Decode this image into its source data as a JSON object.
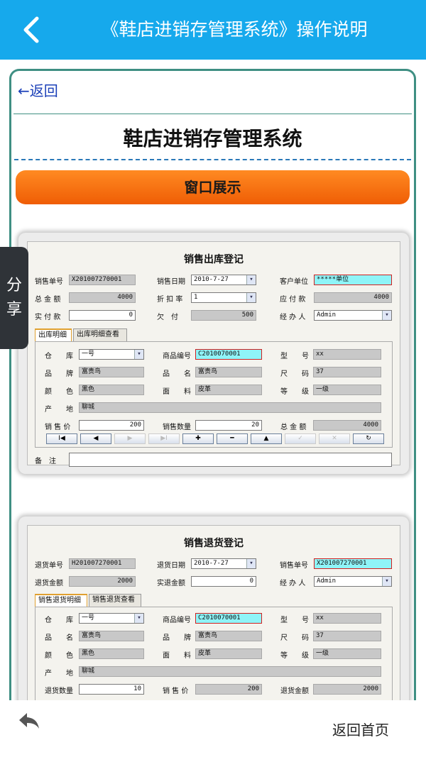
{
  "header": {
    "title": "《鞋店进销存管理系统》操作说明"
  },
  "content": {
    "back_link": "←返回",
    "main_title": "鞋店进销存管理系统",
    "section_title": "窗口展示"
  },
  "share_label": "分享",
  "footer": {
    "home_label": "返回首页"
  },
  "sales_out": {
    "title": "销售出库登记",
    "row1": {
      "l1": "销售单号",
      "v1": "X201007270001",
      "l2": "销售日期",
      "v2": "2010-7-27",
      "l3": "客户单位",
      "v3": "*****单位"
    },
    "row2": {
      "l1": "总 金 额",
      "v1": "4000",
      "l2": "折 扣 率",
      "v2": "1",
      "l3": "应 付 款",
      "v3": "4000"
    },
    "row3": {
      "l1": "实 付 款",
      "v1": "0",
      "l2": "欠　付",
      "v2": "500",
      "l3": "经 办 人",
      "v3": "Admin"
    },
    "tabs": [
      "出库明细",
      "出库明细查看"
    ],
    "detail": {
      "warehouse_l": "仓　　库",
      "warehouse_v": "一号",
      "code_l": "商品编号",
      "code_v": "C2010070001",
      "model_l": "型　　号",
      "model_v": "xx",
      "brand_l": "品　　牌",
      "brand_v": "富贵鸟",
      "name_l": "品　　名",
      "name_v": "富贵鸟",
      "size_l": "尺　　码",
      "size_v": "37",
      "color_l": "颜　　色",
      "color_v": "黑色",
      "material_l": "面　　料",
      "material_v": "皮革",
      "grade_l": "等　　级",
      "grade_v": "一级",
      "origin_l": "产　　地",
      "origin_v": "聊城",
      "price_l": "销 售 价",
      "price_v": "200",
      "qty_l": "销售数量",
      "qty_v": "20",
      "total_l": "总 金 额",
      "total_v": "4000"
    },
    "nav_buttons": [
      "I◀",
      "◀",
      "▶",
      "▶I",
      "✚",
      "━",
      "▲",
      "✓",
      "✕",
      "↻"
    ],
    "remark_l": "备　注"
  },
  "sales_return": {
    "title": "销售退货登记",
    "row1": {
      "l1": "退货单号",
      "v1": "H201007270001",
      "l2": "退货日期",
      "v2": "2010-7-27",
      "l3": "销售单号",
      "v3": "X201007270001"
    },
    "row2": {
      "l1": "退货金额",
      "v1": "2000",
      "l2": "实退金额",
      "v2": "0",
      "l3": "经 办 人",
      "v3": "Admin"
    },
    "tabs": [
      "销售退货明细",
      "销售退货查看"
    ],
    "detail": {
      "warehouse_l": "仓　　库",
      "warehouse_v": "一号",
      "code_l": "商品编号",
      "code_v": "C2010070001",
      "model_l": "型　　号",
      "model_v": "xx",
      "name_l": "品　　名",
      "name_v": "富贵鸟",
      "brand_l": "品　　牌",
      "brand_v": "富贵鸟",
      "size_l": "尺　　码",
      "size_v": "37",
      "color_l": "颜　　色",
      "color_v": "黑色",
      "material_l": "面　　料",
      "material_v": "皮革",
      "grade_l": "等　　级",
      "grade_v": "一级",
      "origin_l": "产　　地",
      "origin_v": "聊城",
      "qty_l": "退货数量",
      "qty_v": "10",
      "price_l": "销 售 价",
      "price_v": "200",
      "total_l": "退货金额",
      "total_v": "2000"
    }
  }
}
